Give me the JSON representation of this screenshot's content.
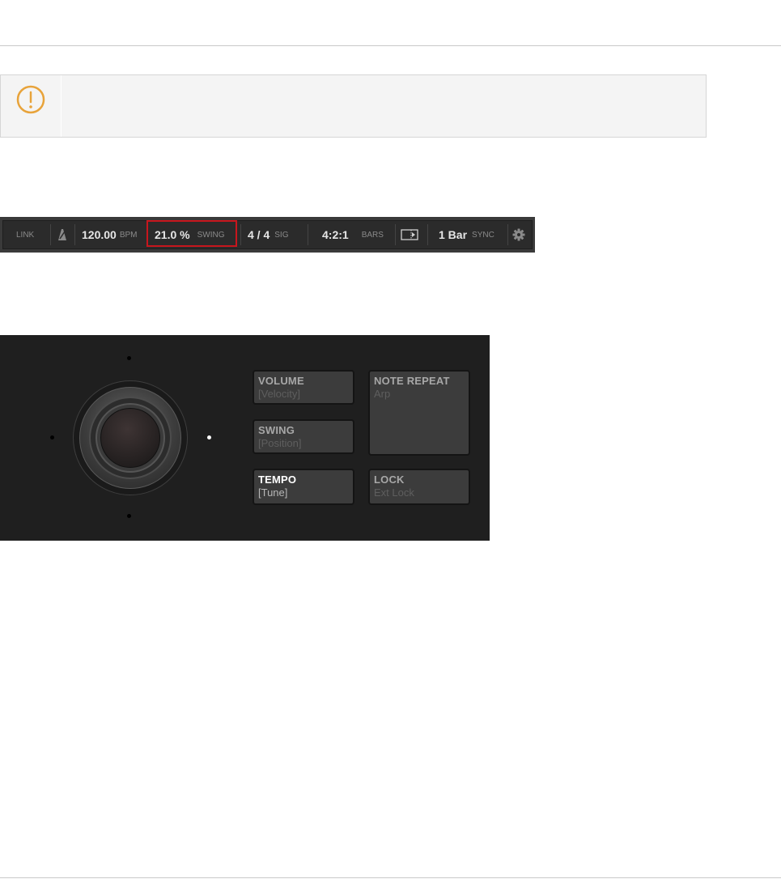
{
  "transport": {
    "link": "LINK",
    "tempo_value": "120.00",
    "tempo_unit": "BPM",
    "swing_value": "21.0 %",
    "swing_unit": "SWING",
    "sig_value": "4 / 4",
    "sig_unit": "SIG",
    "position_value": "4:2:1",
    "position_unit": "BARS",
    "sync_value": "1 Bar",
    "sync_unit": "SYNC",
    "highlight_color": "#c8161d"
  },
  "controller": {
    "buttons": [
      {
        "label": "VOLUME",
        "sub": "[Velocity]"
      },
      {
        "label": "SWING",
        "sub": "[Position]"
      },
      {
        "label": "TEMPO",
        "sub": "[Tune]"
      },
      {
        "label": "NOTE REPEAT",
        "sub": "Arp"
      },
      {
        "label": "LOCK",
        "sub": "Ext Lock"
      }
    ]
  },
  "colors": {
    "notice_icon": "#e8a33a",
    "panel_bg": "#1f1f1f"
  }
}
